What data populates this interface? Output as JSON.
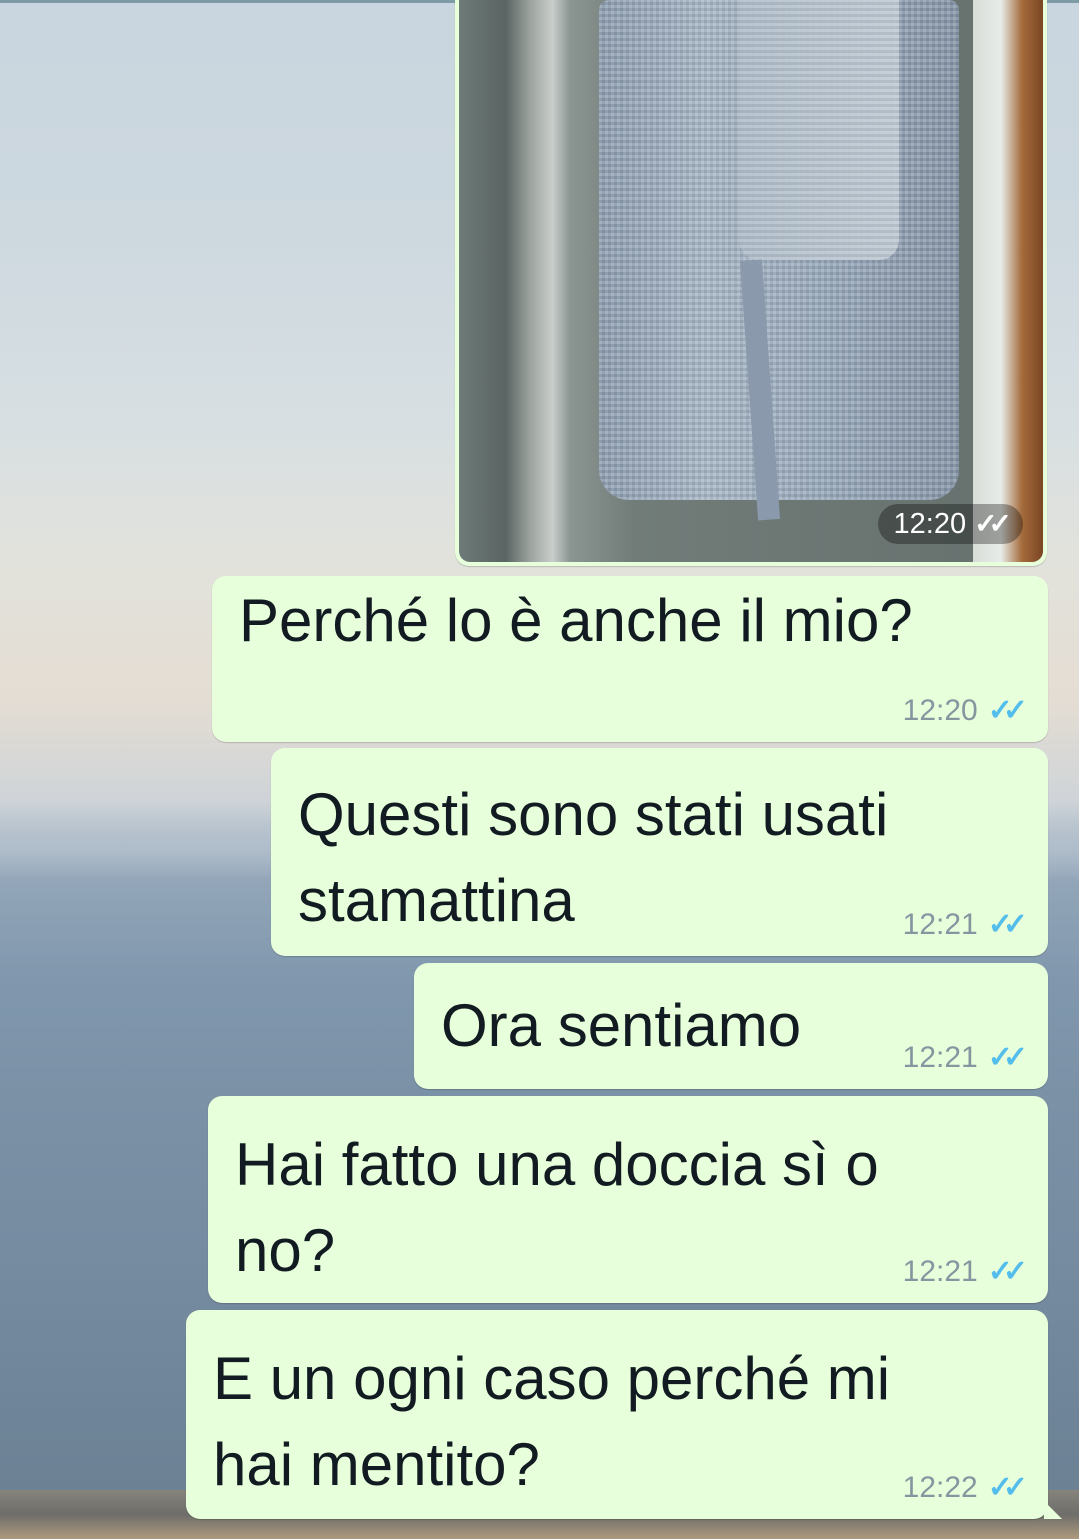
{
  "chat": {
    "image_message": {
      "time": "12:20",
      "status_icon": "double-check-icon"
    },
    "messages": [
      {
        "text": "Perché lo è anche il mio?",
        "time": "12:20"
      },
      {
        "text": "Questi sono stati usati\nstamattina",
        "time": "12:21"
      },
      {
        "text": "Ora sentiamo",
        "time": "12:21"
      },
      {
        "text": "Hai fatto una doccia sì o\nno?",
        "time": "12:21"
      },
      {
        "text": "E un ogni caso perché mi\nhai mentito?",
        "time": "12:22"
      }
    ],
    "read_ticks": "✓✓",
    "colors": {
      "outgoing_bubble": "#e7ffdb",
      "read_ticks": "#53bdeb",
      "time_text": "#8696a0"
    }
  }
}
